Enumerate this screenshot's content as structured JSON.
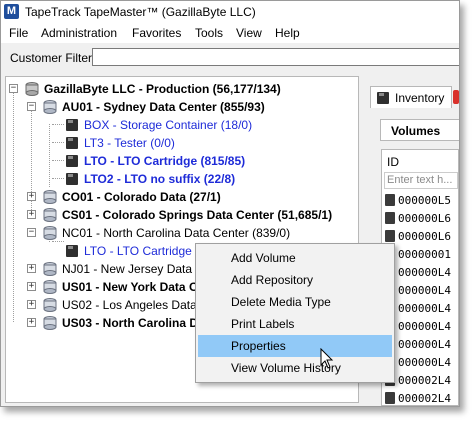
{
  "window": {
    "title": "TapeTrack TapeMaster™ (GazillaByte LLC)",
    "icon_text": "M"
  },
  "menu": [
    "File",
    "Administration",
    "Favorites",
    "Tools",
    "View",
    "Help"
  ],
  "filter": {
    "label": "Customer Filter",
    "value": ""
  },
  "tree": {
    "root": "GazillaByte LLC - Production (56,177/134)",
    "au01": "AU01 - Sydney Data Center (855/93)",
    "au01_box": "BOX - Storage Container (18/0)",
    "au01_lt3": "LT3 - Tester (0/0)",
    "au01_lto": "LTO - LTO Cartridge (815/85)",
    "au01_lto2": "LTO2 - LTO no suffix (22/8)",
    "co01": "CO01 - Colorado Data (27/1)",
    "cs01": "CS01 - Colorado Springs Data Center (51,685/1)",
    "nc01": "NC01 - North Carolina Data Center (839/0)",
    "nc01_lto": "LTO - LTO Cartridge (839/0)",
    "nj01": "NJ01 - New Jersey Data C",
    "us01": "US01 - New York Data C",
    "us02": "US02 - Los Angeles Data",
    "us03": "US03 - North Carolina D"
  },
  "right_pane": {
    "tab_label": "Inventory",
    "subtab_label": "Volumes",
    "column_header": "ID",
    "filter_placeholder": "Enter text h...",
    "volumes": [
      "000000L5",
      "000000L6",
      "000000L6",
      "00000001",
      "000000L4",
      "000000L4",
      "000000L4",
      "000000L4",
      "000000L4",
      "000000L4",
      "000002L4",
      "000002L4",
      "000002L4"
    ]
  },
  "context_menu": {
    "items": [
      "Add Volume",
      "Add Repository",
      "Delete Media Type",
      "Print Labels",
      "Properties",
      "View Volume History"
    ],
    "highlighted": "Properties"
  },
  "colors": {
    "highlight": "#91c9f7",
    "link_blue": "#1e2bd8"
  }
}
